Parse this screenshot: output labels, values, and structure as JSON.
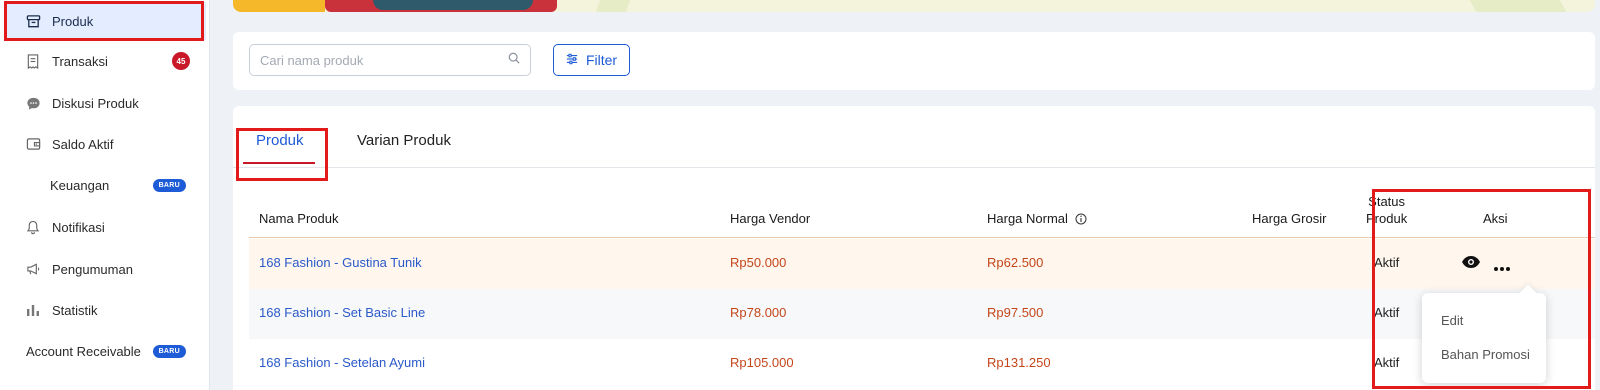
{
  "sidebar": {
    "items": [
      {
        "label": "Produk",
        "icon": "archive-box-icon"
      },
      {
        "label": "Transaksi",
        "icon": "receipt-icon",
        "count": "45"
      },
      {
        "label": "Diskusi Produk",
        "icon": "chat-bubble-icon"
      },
      {
        "label": "Saldo Aktif",
        "icon": "wallet-icon"
      },
      {
        "label": "Keuangan",
        "badge": "BARU"
      },
      {
        "label": "Notifikasi",
        "icon": "bell-icon"
      },
      {
        "label": "Pengumuman",
        "icon": "megaphone-icon"
      },
      {
        "label": "Statistik",
        "icon": "bar-chart-icon"
      },
      {
        "label": "Account Receivable",
        "badge": "BARU"
      }
    ]
  },
  "search": {
    "placeholder": "Cari nama produk",
    "value": ""
  },
  "filter": {
    "label": "Filter"
  },
  "tabs": [
    {
      "label": "Produk"
    },
    {
      "label": "Varian Produk"
    }
  ],
  "table": {
    "headers": {
      "name": "Nama Produk",
      "vendor": "Harga Vendor",
      "normal": "Harga Normal",
      "grosir": "Harga Grosir",
      "status_line1": "Status",
      "status_line2": "Produk",
      "action": "Aksi"
    },
    "rows": [
      {
        "name": "168 Fashion - Gustina Tunik",
        "vendor": "Rp50.000",
        "normal": "Rp62.500",
        "status": "Aktif"
      },
      {
        "name": "168 Fashion - Set Basic Line",
        "vendor": "Rp78.000",
        "normal": "Rp97.500",
        "status": "Aktif"
      },
      {
        "name": "168 Fashion - Setelan Ayumi",
        "vendor": "Rp105.000",
        "normal": "Rp131.250",
        "status": "Aktif"
      }
    ]
  },
  "menu": {
    "edit": "Edit",
    "promo": "Bahan Promosi"
  },
  "colors": {
    "accent": "#1e5bd6",
    "link": "#2a59c9",
    "price": "#c4461a",
    "highlight_row": "#fff6ee",
    "alt_row": "#f7f8fa",
    "annotation_red": "#e31a1a",
    "badge_red": "#c8182a"
  }
}
